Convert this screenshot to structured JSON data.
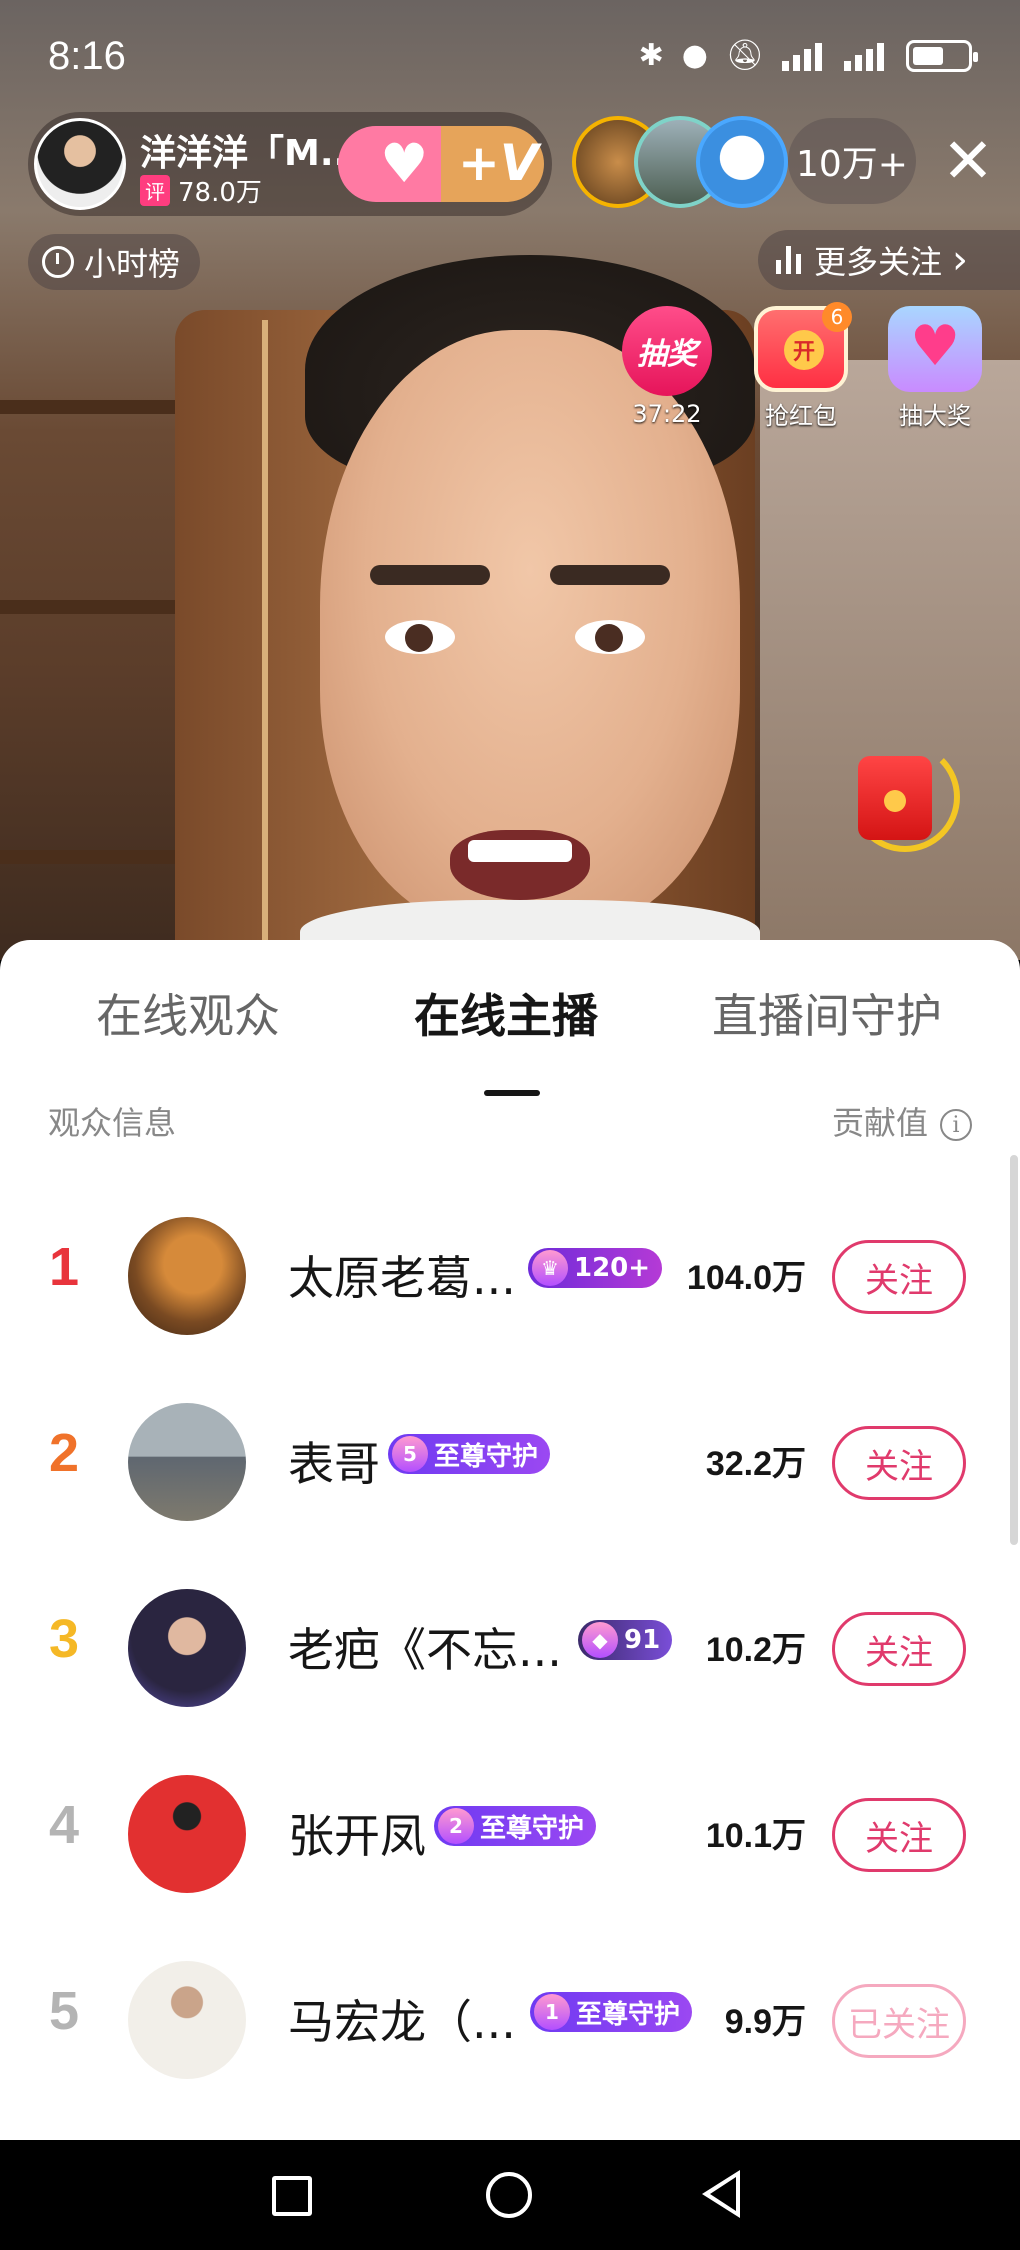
{
  "status_bar": {
    "time": "8:16"
  },
  "anchor": {
    "name": "洋洋洋「M...",
    "score_tag": "评",
    "score": "78.0万",
    "follow_plus": "+",
    "v_label": "+V"
  },
  "viewers": {
    "count": "10万+",
    "close": "✕"
  },
  "hour_rank": {
    "label": "小时榜"
  },
  "more_follow": {
    "label": "更多关注",
    "chevron": "›"
  },
  "widgets": {
    "lottery": {
      "icon_text": "抽奖",
      "countdown": "37:22"
    },
    "redpack": {
      "label": "抢红包",
      "badge": "6"
    },
    "bigprize": {
      "label": "抽大奖"
    }
  },
  "sheet": {
    "tabs": [
      {
        "label": "在线观众",
        "active": false
      },
      {
        "label": "在线主播",
        "active": true
      },
      {
        "label": "直播间守护",
        "active": false
      }
    ],
    "col_left": "观众信息",
    "col_right": "贡献值",
    "info_icon": "i",
    "rows": [
      {
        "rank": "1",
        "rank_color": "#e8343c",
        "name": "太原老葛...",
        "badge_text": "120+",
        "badge_gem": "♛",
        "score": "104.0万",
        "button": "关注",
        "followed": false
      },
      {
        "rank": "2",
        "rank_color": "#f0722a",
        "name": "表哥",
        "badge_text": "至尊守护",
        "badge_gem": "5",
        "score": "32.2万",
        "button": "关注",
        "followed": false
      },
      {
        "rank": "3",
        "rank_color": "#f5b826",
        "name": "老疤《不忘...",
        "badge_text": "91",
        "badge_gem": "◆",
        "score": "10.2万",
        "button": "关注",
        "followed": false
      },
      {
        "rank": "4",
        "rank_color": "#b4b4b4",
        "name": "张开凤",
        "badge_text": "至尊守护",
        "badge_gem": "2",
        "score": "10.1万",
        "button": "关注",
        "followed": false
      },
      {
        "rank": "5",
        "rank_color": "#b4b4b4",
        "name": "马宏龙（...",
        "badge_text": "至尊守护",
        "badge_gem": "1",
        "score": "9.9万",
        "button": "已关注",
        "followed": true
      }
    ]
  },
  "colors": {
    "accent": "#e03a6c",
    "followed": "#f5a9bf",
    "guard_badge": "#7b3ff2"
  }
}
